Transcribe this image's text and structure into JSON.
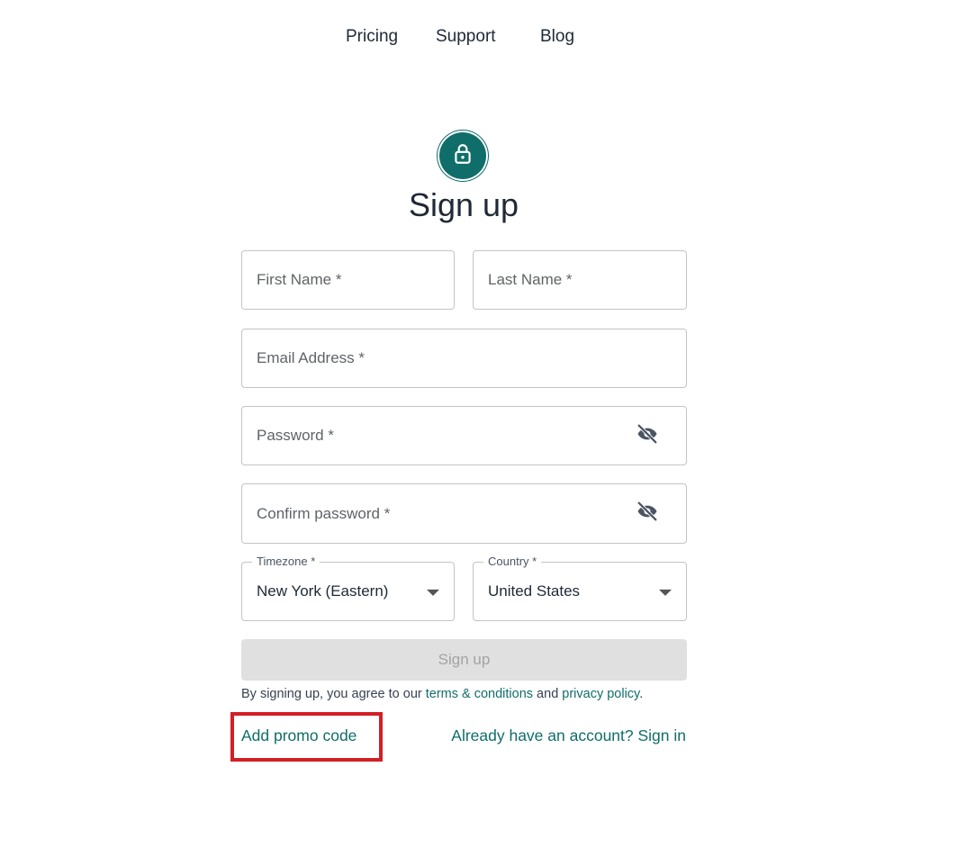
{
  "nav": {
    "pricing": "Pricing",
    "support": "Support",
    "blog": "Blog"
  },
  "header": {
    "icon": "lock-icon",
    "title": "Sign up"
  },
  "form": {
    "first_name_placeholder": "First Name *",
    "last_name_placeholder": "Last Name *",
    "email_placeholder": "Email Address *",
    "password_placeholder": "Password *",
    "confirm_password_placeholder": "Confirm password *",
    "password_toggle_icon": "eye-off-icon",
    "timezone": {
      "label": "Timezone *",
      "value": "New York (Eastern)"
    },
    "country": {
      "label": "Country *",
      "value": "United States"
    },
    "submit_label": "Sign up"
  },
  "terms": {
    "prefix": "By signing up, you agree to our ",
    "terms_link": "terms & conditions",
    "middle": " and ",
    "privacy_link": "privacy policy",
    "suffix": "."
  },
  "footer": {
    "promo_link": "Add promo code",
    "signin_link": "Already have an account? Sign in"
  },
  "colors": {
    "accent": "#0f6e6a",
    "highlight_box": "#d21f26",
    "disabled_button_bg": "#e0e0e0",
    "disabled_button_text": "#a3a3a3"
  }
}
